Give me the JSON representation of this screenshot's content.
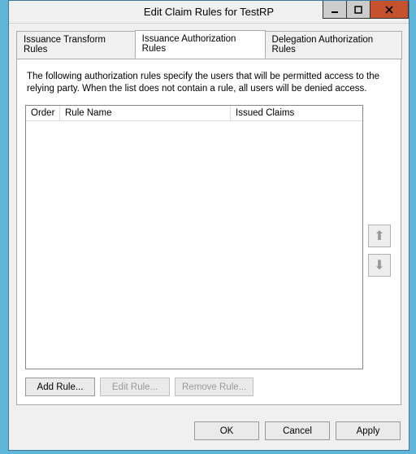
{
  "window": {
    "title": "Edit Claim Rules for TestRP"
  },
  "tabs": {
    "transform": "Issuance Transform Rules",
    "auth": "Issuance Authorization Rules",
    "delegation": "Delegation Authorization Rules"
  },
  "panel": {
    "description": "The following authorization rules specify the users that will be permitted access to the relying party. When the list does not contain a rule, all users will be denied access."
  },
  "columns": {
    "order": "Order",
    "ruleName": "Rule Name",
    "issuedClaims": "Issued Claims"
  },
  "buttons": {
    "addRule": "Add Rule...",
    "editRule": "Edit Rule...",
    "removeRule": "Remove Rule...",
    "ok": "OK",
    "cancel": "Cancel",
    "apply": "Apply"
  },
  "rules": []
}
